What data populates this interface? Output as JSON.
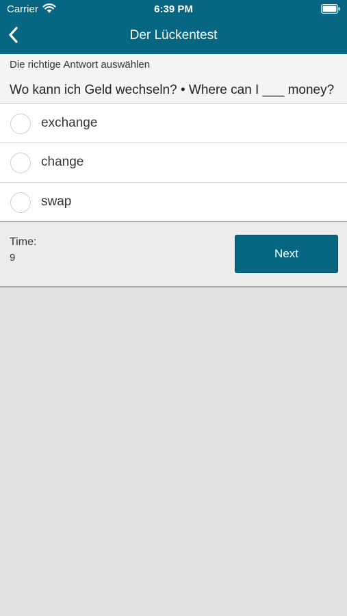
{
  "status_bar": {
    "carrier": "Carrier",
    "time": "6:39 PM",
    "icons": [
      "wifi-icon",
      "battery-icon"
    ]
  },
  "nav": {
    "title": "Der Lückentest",
    "back_icon": "chevron-left-icon"
  },
  "prompt": {
    "instruction": "Die richtige Antwort auswählen",
    "question": "Wo kann ich Geld wechseln? • Where can I ___ money?"
  },
  "options": [
    {
      "label": "exchange",
      "selected": false
    },
    {
      "label": "change",
      "selected": false
    },
    {
      "label": "swap",
      "selected": false
    }
  ],
  "footer": {
    "time_label": "Time:",
    "time_value": "9",
    "next_label": "Next"
  },
  "colors": {
    "primary": "#076682",
    "background": "#e1e1e1"
  }
}
